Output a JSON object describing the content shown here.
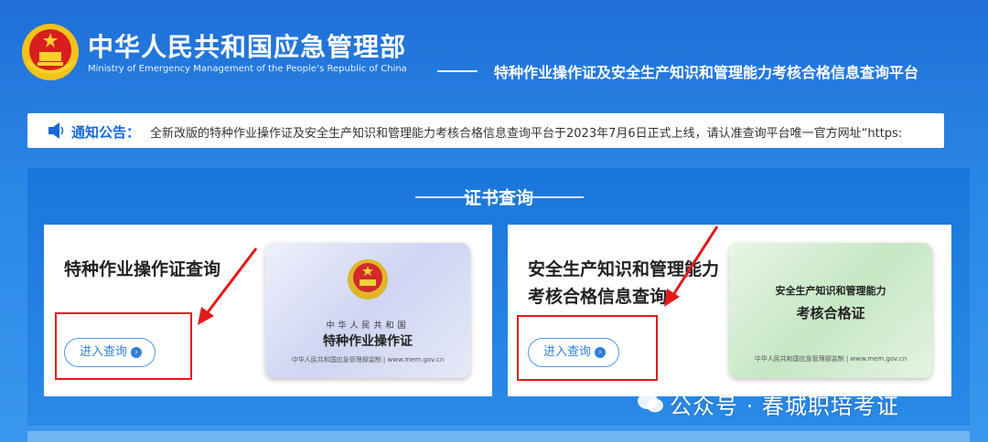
{
  "header": {
    "title": "中华人民共和国应急管理部",
    "subtitle": "Ministry of Emergency Management of the People’s Republic of China",
    "platform_title": "特种作业操作证及安全生产知识和管理能力考核合格信息查询平台"
  },
  "notice": {
    "label": "通知公告：",
    "text": "全新改版的特种作业操作证及安全生产知识和管理能力考核合格信息查询平台于2023年7月6日正式上线，请认准查询平台唯一官方网址“https:"
  },
  "section": {
    "title": "证书查询"
  },
  "cards": [
    {
      "title": "特种作业操作证查询",
      "button": "进入查询",
      "cert": {
        "country": "中华人民共和国",
        "name": "特种作业操作证",
        "footer": "中华人民共和国应急管理部监制 | www.mem.gov.cn"
      }
    },
    {
      "title_line1": "安全生产知识和管理能力",
      "title_line2": "考核合格信息查询",
      "button": "进入查询",
      "cert": {
        "top": "安全生产知识和管理能力",
        "name": "考核合格证",
        "footer": "中华人民共和国应急管理部监制 | www.mem.gov.cn"
      }
    }
  ],
  "watermark": "公众号 · 春城职培考证",
  "colors": {
    "primary_blue": "#1f6fd6",
    "annotation_red": "#e21a1a"
  }
}
